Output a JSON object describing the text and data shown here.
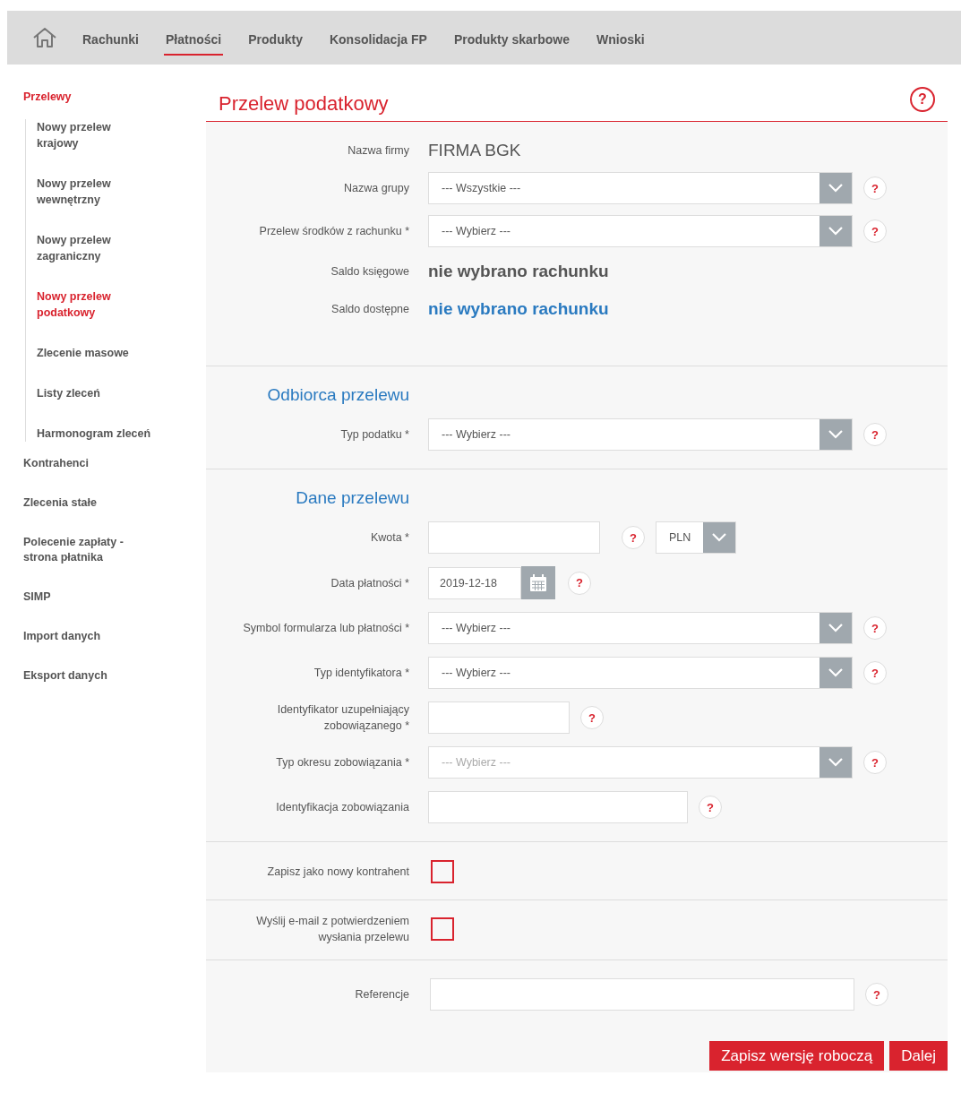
{
  "nav": {
    "items": [
      {
        "label": "Rachunki",
        "selected": false
      },
      {
        "label": "Płatności",
        "selected": true
      },
      {
        "label": "Produkty",
        "selected": false
      },
      {
        "label": "Konsolidacja FP",
        "selected": false
      },
      {
        "label": "Produkty skarbowe",
        "selected": false
      },
      {
        "label": "Wnioski",
        "selected": false
      }
    ]
  },
  "sidebar": {
    "items": [
      {
        "label": "Przelewy",
        "selected": true,
        "expanded": true,
        "children": [
          {
            "label": "Nowy przelew krajowy",
            "selected": false
          },
          {
            "label": "Nowy przelew wewnętrzny",
            "selected": false
          },
          {
            "label": "Nowy przelew zagraniczny",
            "selected": false
          },
          {
            "label": "Nowy przelew podatkowy",
            "selected": true
          },
          {
            "label": "Zlecenie masowe",
            "selected": false
          },
          {
            "label": "Listy zleceń",
            "selected": false
          },
          {
            "label": "Harmonogram zleceń",
            "selected": false
          }
        ]
      },
      {
        "label": "Kontrahenci",
        "selected": false
      },
      {
        "label": "Zlecenia stałe",
        "selected": false
      },
      {
        "label": "Polecenie zapłaty - strona płatnika",
        "selected": false
      },
      {
        "label": "SIMP",
        "selected": false
      },
      {
        "label": "Import danych",
        "selected": false
      },
      {
        "label": "Eksport danych",
        "selected": false
      }
    ]
  },
  "form": {
    "title": "Przelew podatkowy",
    "help": "?",
    "sections": [
      {
        "rows": [
          {
            "kind": "text",
            "label": "Nazwa firmy",
            "value": "FIRMA BGK"
          },
          {
            "kind": "select",
            "label": "Nazwa grupy",
            "value": "--- Wszystkie ---",
            "disabled": false,
            "help": "?"
          },
          {
            "kind": "select",
            "label": "Przelew środków z rachunku *",
            "value": "--- Wybierz ---",
            "disabled": false,
            "help": "?"
          },
          {
            "kind": "balance",
            "label": "Saldo księgowe",
            "value": "nie wybrano rachunku",
            "accent": false
          },
          {
            "kind": "balance",
            "label": "Saldo dostępne",
            "value": "nie wybrano rachunku",
            "accent": true
          }
        ]
      },
      {
        "heading": "Odbiorca przelewu",
        "rows": [
          {
            "kind": "select",
            "label": "Typ podatku *",
            "value": "--- Wybierz ---",
            "disabled": false,
            "help": "?"
          }
        ]
      },
      {
        "heading": "Dane przelewu",
        "rows": [
          {
            "kind": "amount",
            "label": "Kwota *",
            "help": "?",
            "currency": "PLN"
          },
          {
            "kind": "date",
            "label": "Data płatności *",
            "value": "2019-12-18",
            "help": "?"
          },
          {
            "kind": "select",
            "label": "Symbol formularza lub płatności *",
            "value": "--- Wybierz ---",
            "disabled": false,
            "help": "?"
          },
          {
            "kind": "select",
            "label": "Typ identyfikatora *",
            "value": "--- Wybierz ---",
            "disabled": false,
            "help": "?"
          },
          {
            "kind": "shortfield",
            "label": "Identyfikator uzupełniający zobowiązanego *",
            "help": "?"
          },
          {
            "kind": "select",
            "label": "Typ okresu zobowiązania *",
            "value": "--- Wybierz ---",
            "disabled": true,
            "help": "?"
          },
          {
            "kind": "field",
            "label": "Identyfikacja zobowiązania",
            "help": "?"
          }
        ]
      },
      {
        "rows": [
          {
            "kind": "checkbox",
            "label": "Zapisz jako nowy kontrahent",
            "checked": false
          }
        ]
      },
      {
        "rows": [
          {
            "kind": "checkbox",
            "label": "Wyślij e-mail z potwierdzeniem wysłania przelewu",
            "checked": false
          }
        ]
      },
      {
        "rows": [
          {
            "kind": "widefield",
            "label": "Referencje",
            "help": "?"
          }
        ]
      }
    ],
    "buttons": [
      "Zapisz wersję roboczą",
      "Dalej"
    ]
  }
}
